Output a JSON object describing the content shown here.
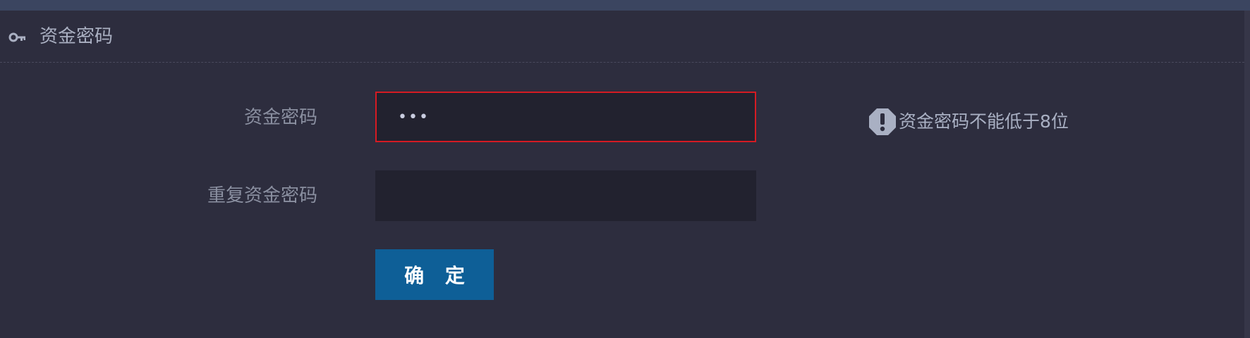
{
  "header": {
    "title": "资金密码",
    "icon": "key-icon"
  },
  "form": {
    "password": {
      "label": "资金密码",
      "value": "•••",
      "state": "error"
    },
    "confirm_password": {
      "label": "重复资金密码",
      "value": ""
    },
    "hint": {
      "icon": "exclamation-icon",
      "text": "资金密码不能低于8位"
    },
    "submit_label": "确 定"
  },
  "colors": {
    "background": "#2d2d3e",
    "topbar": "#3b4560",
    "input_background": "#22222f",
    "error_border": "#d51b23",
    "button": "#0e5f97"
  }
}
